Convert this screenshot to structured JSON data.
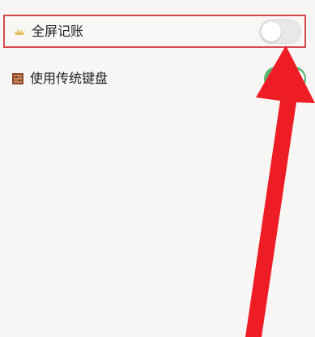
{
  "settings": {
    "items": [
      {
        "label": "全屏记账",
        "icon": "crown-icon",
        "state": "off",
        "highlighted": true
      },
      {
        "label": "使用传统键盘",
        "icon": "abacus-icon",
        "state": "on",
        "highlighted": false
      }
    ]
  },
  "colors": {
    "highlight_border": "#d94a4f",
    "toggle_on": "#59b56e",
    "toggle_off": "#e8e8e8",
    "annotation_arrow": "#ee1c25"
  }
}
